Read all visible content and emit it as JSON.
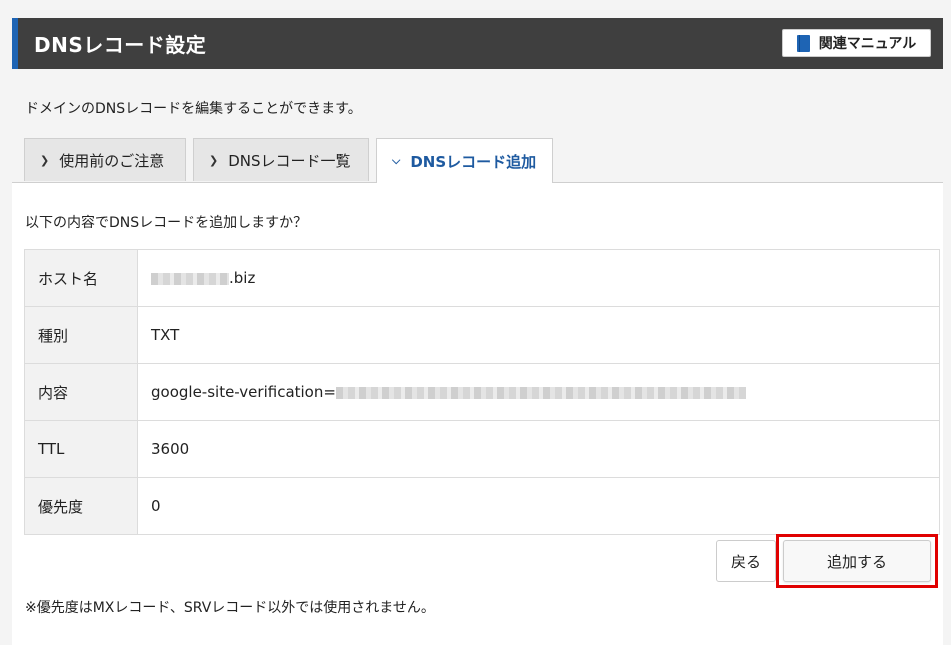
{
  "header": {
    "title": "DNSレコード設定",
    "manual_label": "関連マニュアル"
  },
  "description": "ドメインのDNSレコードを編集することができます。",
  "tabs": [
    {
      "label": "使用前のご注意",
      "active": false,
      "icon": "chevron-right-icon"
    },
    {
      "label": "DNSレコード一覧",
      "active": false,
      "icon": "chevron-right-icon"
    },
    {
      "label": "DNSレコード追加",
      "active": true,
      "icon": "chevron-down-icon"
    }
  ],
  "confirm_question": "以下の内容でDNSレコードを追加しますか？",
  "record": {
    "host_label": "ホスト名",
    "host_value": ".biz",
    "type_label": "種別",
    "type_value": "TXT",
    "content_label": "内容",
    "content_value": "google-site-verification=",
    "ttl_label": "TTL",
    "ttl_value": "3600",
    "priority_label": "優先度",
    "priority_value": "0"
  },
  "buttons": {
    "back": "戻る",
    "add": "追加する"
  },
  "note": "※優先度はMXレコード、SRVレコード以外では使用されません。",
  "colors": {
    "header_bg": "#3f3f3f",
    "accent_blue": "#1e64b4",
    "highlight_red": "#e00000"
  }
}
